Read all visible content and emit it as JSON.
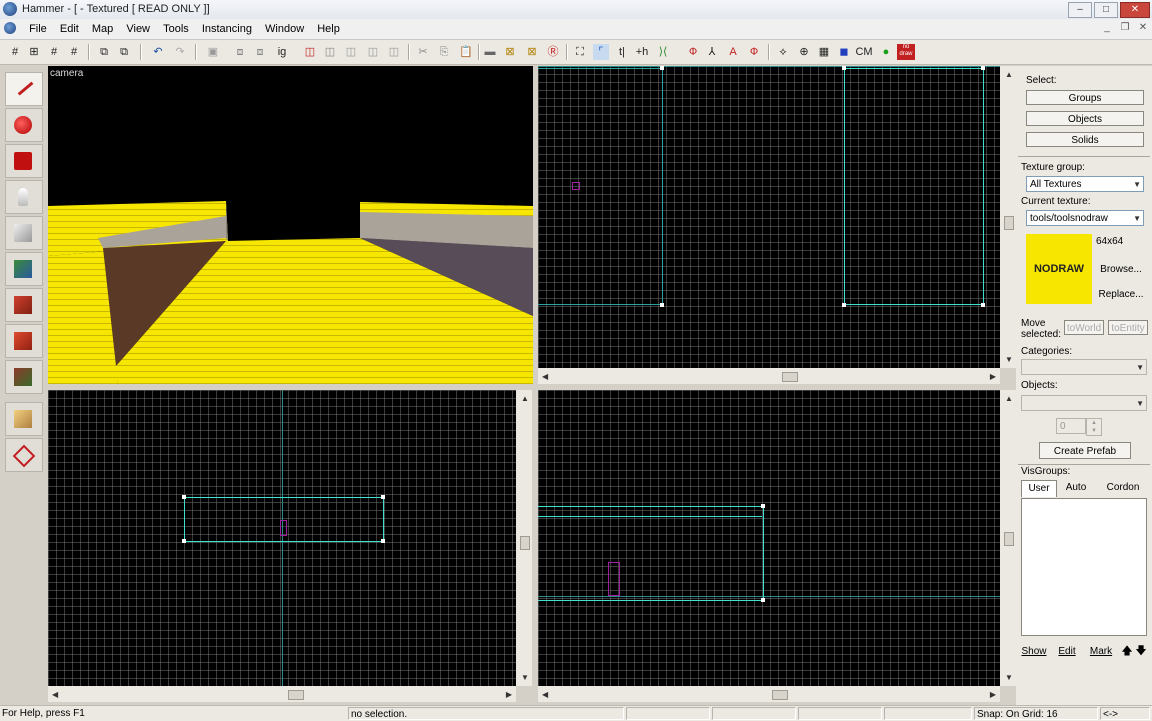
{
  "window": {
    "title": "Hammer - [ - Textured [ READ ONLY ]]",
    "min": "–",
    "max": "□",
    "close": "✕"
  },
  "menu": [
    "File",
    "Edit",
    "Map",
    "View",
    "Tools",
    "Instancing",
    "Window",
    "Help"
  ],
  "mdi": {
    "min": "_",
    "restore": "❐",
    "close": "✕"
  },
  "toolbar": {
    "cm_label": "CM",
    "nodraw_label": "no draw"
  },
  "viewports": {
    "camera_label": "camera"
  },
  "right_panel": {
    "select_label": "Select:",
    "select_buttons": [
      "Groups",
      "Objects",
      "Solids"
    ],
    "texture_group_label": "Texture group:",
    "texture_group_value": "All Textures",
    "current_texture_label": "Current texture:",
    "current_texture_value": "tools/toolsnodraw",
    "texture_size": "64x64",
    "texture_preview_text": "NODRAW",
    "browse_label": "Browse...",
    "replace_label": "Replace...",
    "move_selected_label": "Move selected:",
    "to_world_label": "toWorld",
    "to_entity_label": "toEntity",
    "categories_label": "Categories:",
    "objects_label": "Objects:",
    "spinner_value": "0",
    "create_prefab_label": "Create Prefab",
    "visgroups_label": "VisGroups:",
    "vis_tabs": [
      "User",
      "Auto",
      "Cordon"
    ],
    "show_label": "Show",
    "edit_label": "Edit",
    "mark_label": "Mark",
    "up_arrow": "🡅",
    "down_arrow": "🡇"
  },
  "status": {
    "help": "For Help, press F1",
    "selection": "no selection.",
    "snap": "Snap: On Grid: 16",
    "extra": "<->"
  },
  "colors": {
    "nodraw_yellow": "#f7e600",
    "selection_cyan": "#40e0d0",
    "grid_axis": "#2a8a8a"
  }
}
